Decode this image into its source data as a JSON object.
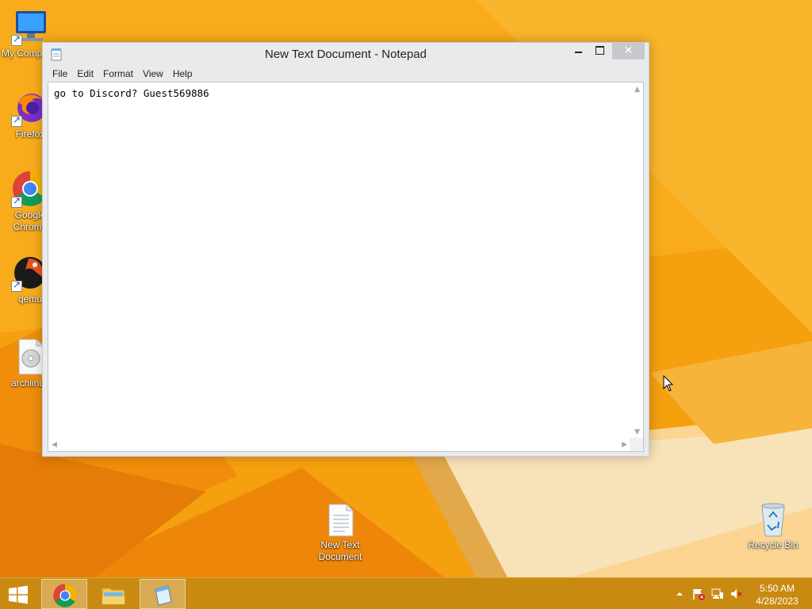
{
  "desktop": {
    "icons": [
      {
        "label": "My Computer",
        "icon": "computer-icon"
      },
      {
        "label": "Firefox",
        "icon": "firefox-icon"
      },
      {
        "label": "Google\nChrome",
        "icon": "chrome-icon"
      },
      {
        "label": "qemu",
        "icon": "qemu-icon"
      },
      {
        "label": "archlinux",
        "icon": "disc-image-icon"
      },
      {
        "label": "New Text\nDocument",
        "icon": "text-document-icon"
      },
      {
        "label": "Recycle Bin",
        "icon": "recycle-bin-icon"
      }
    ]
  },
  "window": {
    "title": "New Text Document - Notepad",
    "close_symbol": "✕",
    "menu": [
      "File",
      "Edit",
      "Format",
      "View",
      "Help"
    ],
    "content": "go to Discord? Guest569886"
  },
  "taskbar": {
    "buttons": [
      {
        "name": "chrome",
        "icon": "chrome-icon"
      },
      {
        "name": "file-explorer",
        "icon": "folder-icon"
      },
      {
        "name": "notepad",
        "icon": "notepad-icon",
        "active": true
      }
    ],
    "tray_icons": [
      "chevron-up-icon",
      "action-center-flag-icon",
      "network-icon",
      "volume-muted-icon"
    ],
    "clock_time": "5:50 AM",
    "clock_date": "4/28/2023"
  },
  "colors": {
    "wallpaper_primary": "#f6a210",
    "wallpaper_light": "#fbd58a",
    "taskbar": "#c98a12",
    "window_frame": "#e9eaec"
  }
}
